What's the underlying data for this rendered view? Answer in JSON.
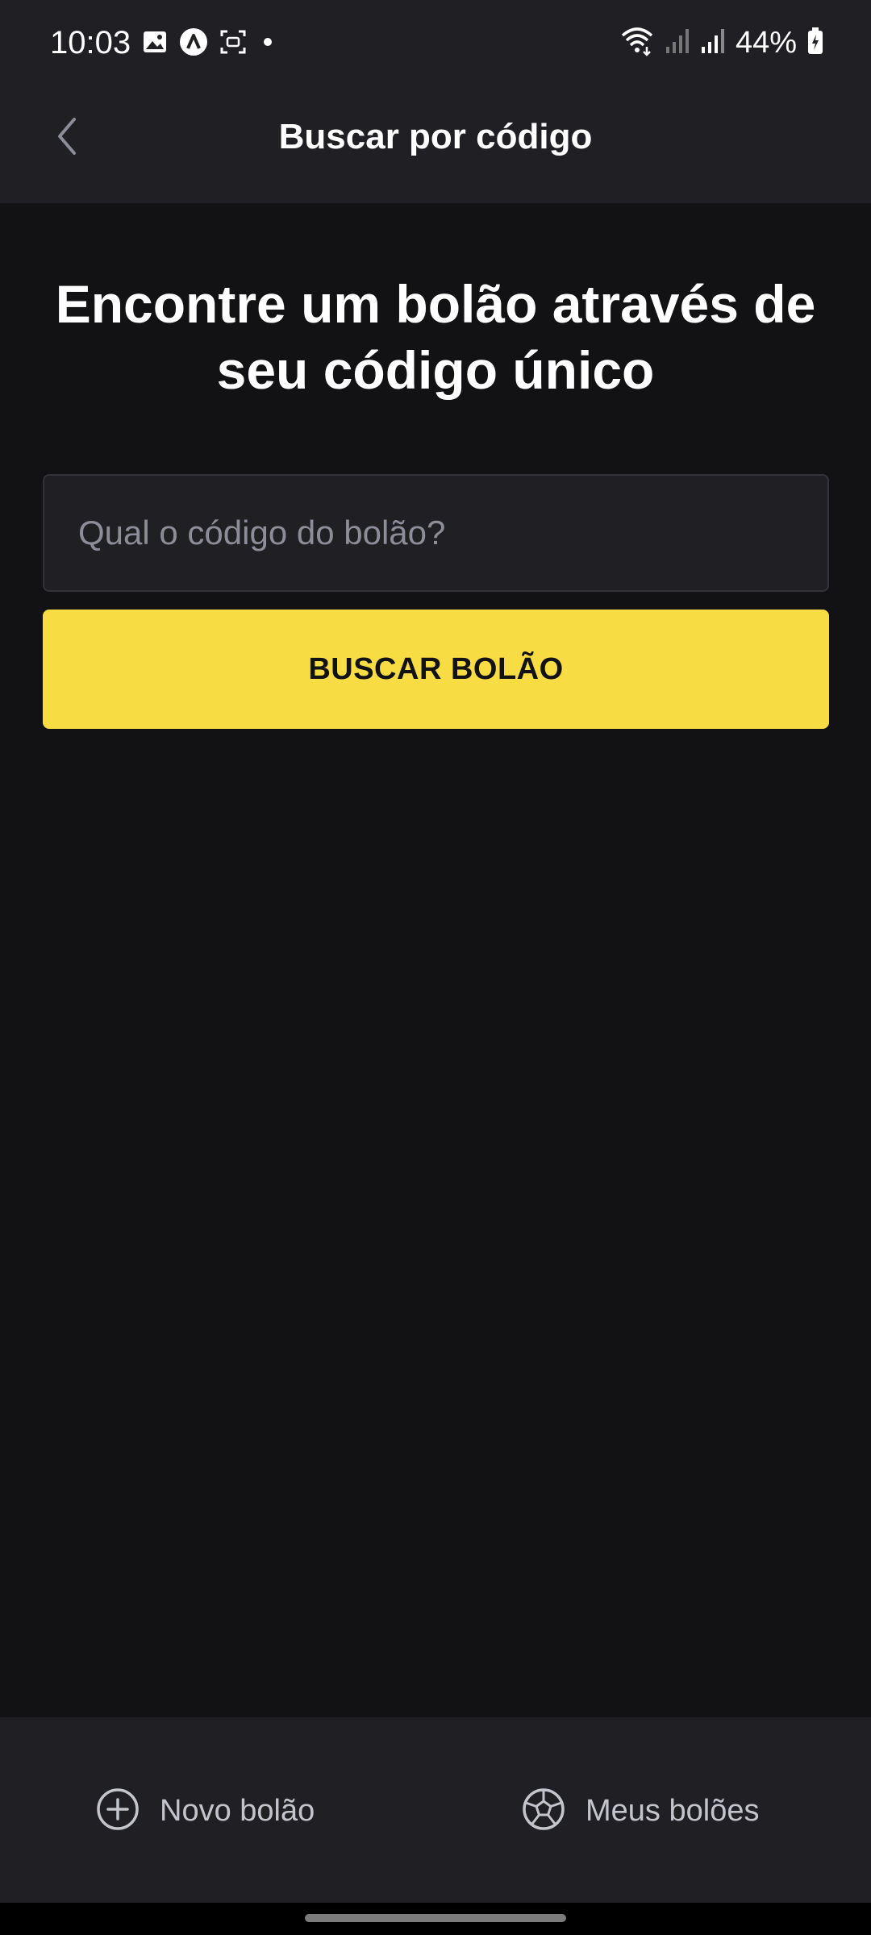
{
  "status_bar": {
    "time": "10:03",
    "battery": "44%",
    "icons": [
      "image-icon",
      "app-a-icon",
      "screen-capture-icon",
      "dot-icon",
      "wifi-icon",
      "signal-icon",
      "signal-icon",
      "battery-charging-icon"
    ]
  },
  "header": {
    "title": "Buscar por código",
    "back_icon": "chevron-left-icon"
  },
  "main": {
    "heading": "Encontre um bolão através de seu código único",
    "input_placeholder": "Qual o código do bolão?",
    "input_value": "",
    "search_button_label": "BUSCAR BOLÃO"
  },
  "tabs": [
    {
      "label": "Novo bolão",
      "icon": "plus-circle-icon"
    },
    {
      "label": "Meus bolões",
      "icon": "soccer-ball-icon"
    }
  ],
  "colors": {
    "background": "#121214",
    "surface": "#202024",
    "accent": "#F7DD43",
    "muted_text": "#8D8D99"
  }
}
